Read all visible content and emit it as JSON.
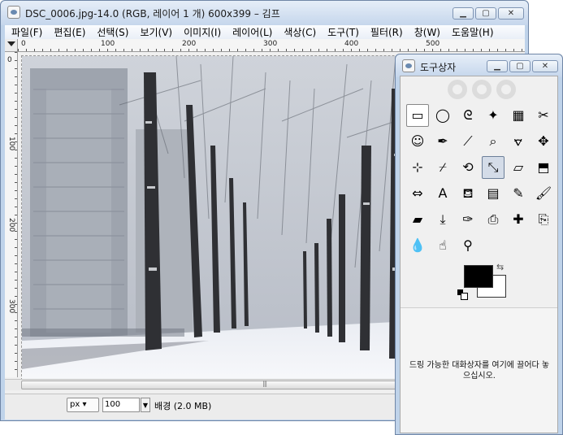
{
  "main_window": {
    "title": "DSC_0006.jpg-14.0 (RGB, 레이어 1 개) 600x399 – 김프",
    "menu": [
      "파일(F)",
      "편집(E)",
      "선택(S)",
      "보기(V)",
      "이미지(I)",
      "레이어(L)",
      "색상(C)",
      "도구(T)",
      "필터(R)",
      "창(W)",
      "도움말(H)"
    ],
    "ruler_h_labels": [
      "0",
      "100",
      "200",
      "300",
      "400",
      "500"
    ],
    "ruler_v_labels": [
      "0",
      "100",
      "200",
      "300"
    ],
    "status": {
      "unit": "px",
      "zoom": "100",
      "info": "배경 (2.0 MB)"
    }
  },
  "toolbox": {
    "title": "도구상자",
    "tools": [
      {
        "name": "rect-select-icon",
        "glyph": "▭"
      },
      {
        "name": "ellipse-select-icon",
        "glyph": "◯"
      },
      {
        "name": "lasso-select-icon",
        "glyph": "ᘓ"
      },
      {
        "name": "fuzzy-select-icon",
        "glyph": "✦"
      },
      {
        "name": "select-by-color-icon",
        "glyph": "▦"
      },
      {
        "name": "scissors-select-icon",
        "glyph": "✂"
      },
      {
        "name": "foreground-select-icon",
        "glyph": "☺"
      },
      {
        "name": "paths-icon",
        "glyph": "✒"
      },
      {
        "name": "color-picker-icon",
        "glyph": "⟋"
      },
      {
        "name": "zoom-icon",
        "glyph": "⌕"
      },
      {
        "name": "measure-icon",
        "glyph": "⦡"
      },
      {
        "name": "move-icon",
        "glyph": "✥"
      },
      {
        "name": "align-icon",
        "glyph": "⊹"
      },
      {
        "name": "crop-icon",
        "glyph": "⌿"
      },
      {
        "name": "rotate-icon",
        "glyph": "⟲"
      },
      {
        "name": "scale-icon",
        "glyph": "⤡"
      },
      {
        "name": "shear-icon",
        "glyph": "▱"
      },
      {
        "name": "perspective-icon",
        "glyph": "⬒"
      },
      {
        "name": "flip-icon",
        "glyph": "⇔"
      },
      {
        "name": "text-icon",
        "glyph": "A"
      },
      {
        "name": "bucket-fill-icon",
        "glyph": "⛾"
      },
      {
        "name": "blend-icon",
        "glyph": "▤"
      },
      {
        "name": "pencil-icon",
        "glyph": "✎"
      },
      {
        "name": "paintbrush-icon",
        "glyph": "🖌"
      },
      {
        "name": "eraser-icon",
        "glyph": "▰"
      },
      {
        "name": "airbrush-icon",
        "glyph": "⤓"
      },
      {
        "name": "ink-icon",
        "glyph": "✑"
      },
      {
        "name": "clone-icon",
        "glyph": "⎙"
      },
      {
        "name": "heal-icon",
        "glyph": "✚"
      },
      {
        "name": "perspective-clone-icon",
        "glyph": "⎘"
      },
      {
        "name": "blur-sharpen-icon",
        "glyph": "💧"
      },
      {
        "name": "smudge-icon",
        "glyph": "☝"
      },
      {
        "name": "dodge-burn-icon",
        "glyph": "⚲"
      }
    ],
    "active_tool": "scale-icon",
    "colors": {
      "foreground": "#000000",
      "background": "#ffffff"
    },
    "drop_text": "드링 가능한 대화상자를 여기에 끌어다 놓으십시오."
  }
}
